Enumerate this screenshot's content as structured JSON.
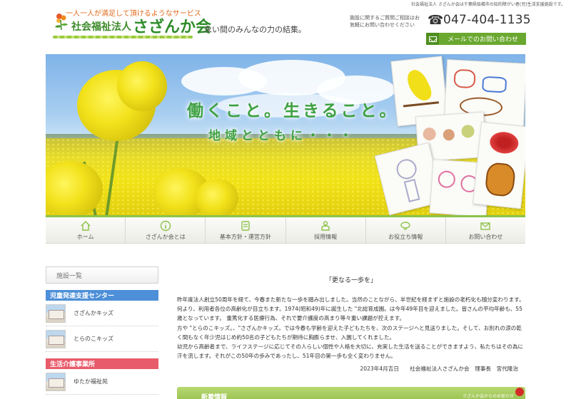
{
  "header": {
    "topline": "社会福祉法人 さざんか会は千葉県船橋市の知的障がい者(児)生活支援施設です。",
    "tagline": "一人一人が満足して頂けるようなサービス",
    "org_type": "社会福祉法人",
    "org_name": "さざんか会",
    "slogan": "永い間のみんなの力の結集。",
    "contact_note": "施設に関するご質問ご相談はお気軽にお問い合わせください",
    "phone": "047-404-1135",
    "mail_button": "メールでのお問い合わせ"
  },
  "hero": {
    "line1": "働くこと。生きること。",
    "line2": "地域とともに・・・"
  },
  "nav": {
    "items": [
      {
        "label": "ホーム",
        "icon": "home-icon"
      },
      {
        "label": "さざんか会とは",
        "icon": "info-icon"
      },
      {
        "label": "基本方針・運営方針",
        "icon": "scroll-icon"
      },
      {
        "label": "採用情報",
        "icon": "person-icon"
      },
      {
        "label": "お役立ち情報",
        "icon": "lightbulb-icon"
      },
      {
        "label": "お問い合わせ",
        "icon": "mail-icon"
      }
    ]
  },
  "sidebar": {
    "facility_tab": "施設一覧",
    "categories": [
      {
        "name": "児童発達支援センター",
        "color": "#4d8fd8",
        "items": [
          {
            "name": "さざんかキッズ"
          },
          {
            "name": "とらのこキッズ"
          }
        ]
      },
      {
        "name": "生活介護事業所",
        "color": "#e85b6a",
        "items": [
          {
            "name": "ゆたか福祉苑"
          }
        ]
      }
    ]
  },
  "article": {
    "title": "「更なる一歩を」",
    "paragraphs": [
      "昨年度法人創立50周年を経て、今春また新たな一歩を踏み出しました。当然のことながら、半世紀を経まずと施設の老朽化も随分変わります。 何より、利用者各位の高齢化が目立ちます。1974(昭和49)年に誕生した \"北総育成園。は今年49年目を迎えました。皆さんの平均年齢も、55歳となっています。 重篤化する医療行為、それで要介護度の高まり等々重い課題が控えます。",
      "方や \"とらのこキッズ。、\"さざんかキッズ。では今春も学齢を迎えた子どもたちを、次のステージへと見送りました。そして、お別れの涙の乾く間もなく年少児はじめ約50名の子どもたちが期待に胸膨らませ、入園してくれました。",
      "幼児から高齢者まで、ライフステージに応じてその人らしい個性や人格を大切に、充実した生活を送ることができますよう、私たちはその為に汗を流します。それがこの50年の歩みであったし、51年目の第一歩も全く変わりません。"
    ],
    "signature": "2023年4月吉日　　社会福祉法人さざんか会　理事長　宮代隆治"
  },
  "news": {
    "label": "新着情報",
    "right_text": "さざんか会からのお知らせ"
  },
  "colors": {
    "brand_green": "#3ea142",
    "nav_accent": "#8bc34a",
    "category_blue": "#4d8fd8",
    "category_red": "#e85b6a",
    "orange": "#e06a1c"
  }
}
